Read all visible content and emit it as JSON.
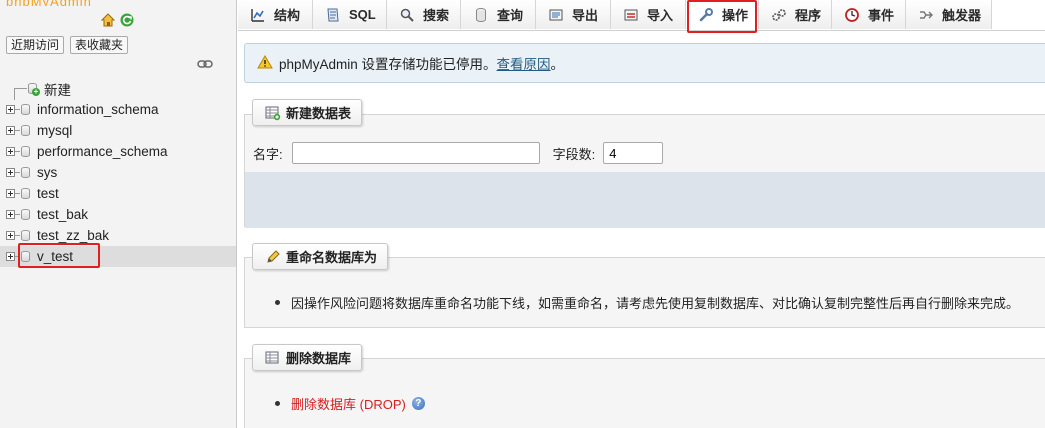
{
  "nav": {
    "logo_text": "phpMyAdmin",
    "quick_links": [
      {
        "label": "近期访问"
      },
      {
        "label": "表收藏夹"
      }
    ],
    "new_label": "新建",
    "databases": [
      {
        "name": "information_schema"
      },
      {
        "name": "mysql"
      },
      {
        "name": "performance_schema"
      },
      {
        "name": "sys"
      },
      {
        "name": "test"
      },
      {
        "name": "test_bak"
      },
      {
        "name": "test_zz_bak"
      },
      {
        "name": "v_test",
        "selected": true
      }
    ]
  },
  "tabs": [
    {
      "label": "结构",
      "icon": "structure-icon"
    },
    {
      "label": "SQL",
      "icon": "sql-icon"
    },
    {
      "label": "搜索",
      "icon": "search-icon"
    },
    {
      "label": "查询",
      "icon": "query-icon"
    },
    {
      "label": "导出",
      "icon": "export-icon"
    },
    {
      "label": "导入",
      "icon": "import-icon"
    },
    {
      "label": "操作",
      "icon": "wrench-icon",
      "active": true
    },
    {
      "label": "程序",
      "icon": "routines-icon"
    },
    {
      "label": "事件",
      "icon": "clock-icon"
    },
    {
      "label": "触发器",
      "icon": "triggers-icon"
    }
  ],
  "notice": {
    "text": "phpMyAdmin 设置存储功能已停用。",
    "link": "查看原因",
    "trailing": "。"
  },
  "create_table": {
    "legend": "新建数据表",
    "name_label": "名字:",
    "name_value": "",
    "fields_label": "字段数:",
    "fields_value": "4"
  },
  "rename_db": {
    "legend": "重命名数据库为",
    "message": "因操作风险问题将数据库重命名功能下线，如需重命名，请考虑先使用复制数据库、对比确认复制完整性后再自行删除来完成。"
  },
  "drop_db": {
    "legend": "删除数据库",
    "link": "删除数据库 (DROP)"
  },
  "colors": {
    "highlight": "#e02020",
    "link": "#235a81",
    "drop_link": "#d52020",
    "notice_bg": "#eaf1f7"
  }
}
